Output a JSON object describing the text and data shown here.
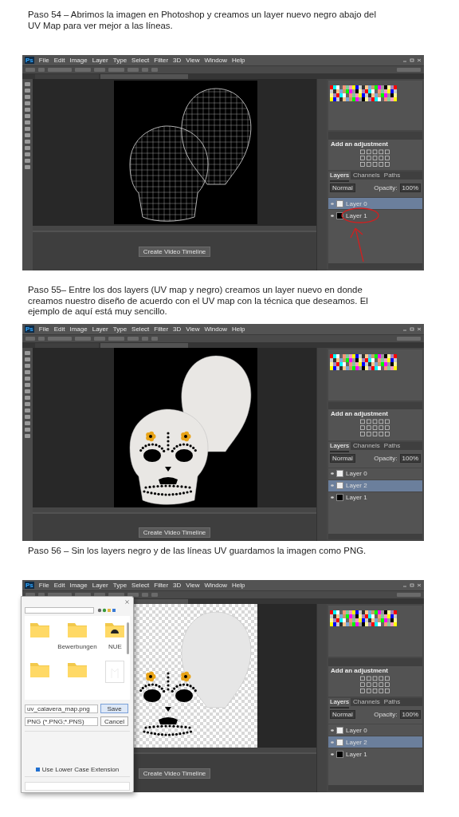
{
  "steps": [
    {
      "text": "Paso 54 – Abrimos la imagen en Photoshop y creamos un layer nuevo negro abajo del UV Map para ver mejor a las líneas.",
      "screenshot": {
        "logo": "Ps",
        "menu": [
          "File",
          "Edit",
          "Image",
          "Layer",
          "Type",
          "Select",
          "Filter",
          "3D",
          "View",
          "Window",
          "Help"
        ],
        "canvas": {
          "kind": "wireframe"
        },
        "adjustments_title": "Add an adjustment",
        "layer_tabs": [
          {
            "label": "Layers",
            "selected": true
          },
          {
            "label": "Channels",
            "selected": false
          },
          {
            "label": "Paths",
            "selected": false
          }
        ],
        "blend_mode": "Normal",
        "opacity_label": "Opacity:",
        "opacity": "100%",
        "layers": [
          {
            "name": "Layer 0",
            "selected": true,
            "kind": "white"
          },
          {
            "name": "Layer 1",
            "selected": false,
            "kind": "black"
          }
        ],
        "annotation": true,
        "timeline_button": "Create Video Timeline"
      }
    },
    {
      "text": "Paso 55– Entre los dos layers (UV map y negro) creamos un layer nuevo en donde creamos nuestro diseño de acuerdo con el UV map con la técnica que deseamos. El ejemplo de aquí está muy sencillo.",
      "screenshot": {
        "logo": "Ps",
        "menu": [
          "File",
          "Edit",
          "Image",
          "Layer",
          "Type",
          "Select",
          "Filter",
          "3D",
          "View",
          "Window",
          "Help"
        ],
        "canvas": {
          "kind": "painted"
        },
        "adjustments_title": "Add an adjustment",
        "layer_tabs": [
          {
            "label": "Layers",
            "selected": true
          },
          {
            "label": "Channels",
            "selected": false
          },
          {
            "label": "Paths",
            "selected": false
          }
        ],
        "blend_mode": "Normal",
        "opacity_label": "Opacity:",
        "opacity": "100%",
        "layers": [
          {
            "name": "Layer 0",
            "selected": false,
            "kind": "white"
          },
          {
            "name": "Layer 2",
            "selected": true,
            "kind": "white"
          },
          {
            "name": "Layer 1",
            "selected": false,
            "kind": "black"
          }
        ],
        "annotation": false,
        "timeline_button": "Create Video Timeline"
      }
    },
    {
      "text": "Paso 56 – Sin los layers negro y de las líneas UV guardamos la imagen como PNG.",
      "screenshot": {
        "logo": "Ps",
        "menu": [
          "File",
          "Edit",
          "Image",
          "Layer",
          "Type",
          "Select",
          "Filter",
          "3D",
          "View",
          "Window",
          "Help"
        ],
        "canvas": {
          "kind": "transparent"
        },
        "adjustments_title": "Add an adjustment",
        "layer_tabs": [
          {
            "label": "Layers",
            "selected": true
          },
          {
            "label": "Channels",
            "selected": false
          },
          {
            "label": "Paths",
            "selected": false
          }
        ],
        "blend_mode": "Normal",
        "opacity_label": "Opacity:",
        "opacity": "100%",
        "layers": [
          {
            "name": "Layer 0",
            "selected": false,
            "kind": "white"
          },
          {
            "name": "Layer 2",
            "selected": true,
            "kind": "white"
          },
          {
            "name": "Layer 1",
            "selected": false,
            "kind": "black"
          }
        ],
        "annotation": false,
        "timeline_button": "Create Video Timeline",
        "dialog": {
          "folders": [
            "Bewerbungen",
            "NUE"
          ],
          "file_name": "uv_calavera_map.png",
          "format": "PNG (*.PNG;*.PNS)",
          "save_button": "Save",
          "cancel_button": "Cancel",
          "lowercase_label": "Use Lower Case Extension",
          "lowercase_checked": true
        }
      }
    }
  ]
}
